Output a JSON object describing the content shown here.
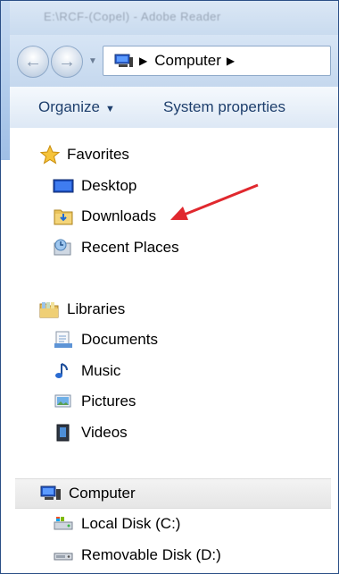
{
  "window": {
    "title_blurred": "E:\\RCF-(Copel) - Adobe Reader"
  },
  "address_bar": {
    "crumbs": [
      "Computer"
    ]
  },
  "toolbar": {
    "organize_label": "Organize",
    "system_properties_label": "System properties"
  },
  "nav_pane": {
    "favorites": {
      "label": "Favorites",
      "items": [
        {
          "label": "Desktop",
          "icon": "desktop-icon"
        },
        {
          "label": "Downloads",
          "icon": "downloads-folder-icon"
        },
        {
          "label": "Recent Places",
          "icon": "recent-places-icon"
        }
      ]
    },
    "libraries": {
      "label": "Libraries",
      "items": [
        {
          "label": "Documents",
          "icon": "documents-library-icon"
        },
        {
          "label": "Music",
          "icon": "music-library-icon"
        },
        {
          "label": "Pictures",
          "icon": "pictures-library-icon"
        },
        {
          "label": "Videos",
          "icon": "videos-library-icon"
        }
      ]
    },
    "computer": {
      "label": "Computer",
      "items": [
        {
          "label": "Local Disk (C:)",
          "icon": "local-disk-icon"
        },
        {
          "label": "Removable Disk (D:)",
          "icon": "removable-disk-icon"
        }
      ]
    }
  },
  "colors": {
    "annotation_arrow": "#e0282e",
    "toolbar_text": "#1e3f6d"
  }
}
